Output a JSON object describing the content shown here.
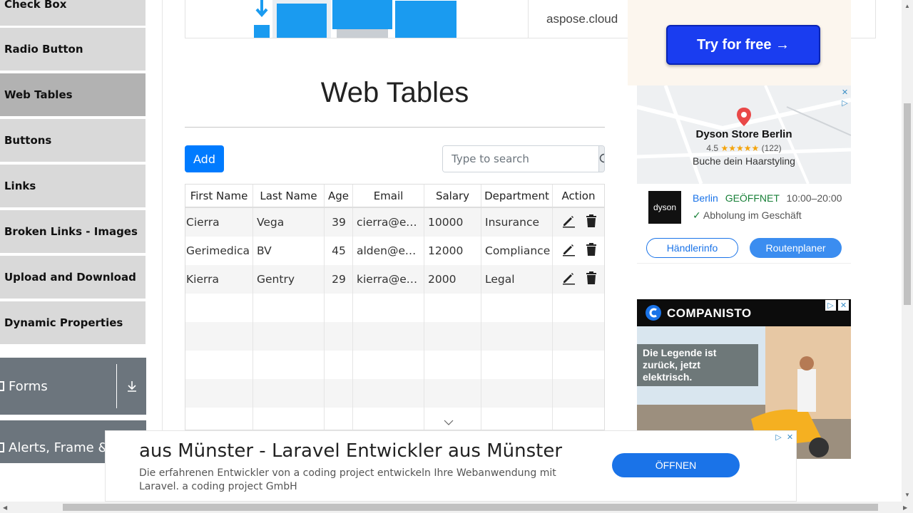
{
  "sidebar": {
    "items": [
      {
        "label": "Check Box"
      },
      {
        "label": "Radio Button"
      },
      {
        "label": "Web Tables",
        "active": true
      },
      {
        "label": "Buttons"
      },
      {
        "label": "Links"
      },
      {
        "label": "Broken Links - Images"
      },
      {
        "label": "Upload and Download"
      },
      {
        "label": "Dynamic Properties"
      }
    ],
    "groups": [
      {
        "label": "Forms",
        "icon": "download-icon"
      },
      {
        "label": "Alerts, Frame &"
      }
    ]
  },
  "top_banner": {
    "domain_text": "aspose.cloud"
  },
  "page": {
    "title": "Web Tables"
  },
  "toolbar": {
    "add_label": "Add"
  },
  "search": {
    "placeholder": "Type to search"
  },
  "table": {
    "columns": [
      "First Name",
      "Last Name",
      "Age",
      "Email",
      "Salary",
      "Department",
      "Action"
    ],
    "rows": [
      {
        "first": "Cierra",
        "last": "Vega",
        "age": "39",
        "email": "cierra@example.com",
        "salary": "10000",
        "department": "Insurance"
      },
      {
        "first": "Gerimedica",
        "last": "BV",
        "age": "45",
        "email": "alden@example.com",
        "salary": "12000",
        "department": "Compliance"
      },
      {
        "first": "Kierra",
        "last": "Gentry",
        "age": "29",
        "email": "kierra@example.com",
        "salary": "2000",
        "department": "Legal"
      }
    ],
    "empty_rows": 5
  },
  "ads": {
    "try": {
      "label": "Try for free →"
    },
    "dyson": {
      "store_name": "Dyson Store Berlin",
      "rating": "4.5",
      "stars": "★★★★★",
      "review_count": "(122)",
      "tagline": "Buche dein Haarstyling",
      "logo_text": "dyson",
      "city": "Berlin",
      "status": "GEÖFFNET",
      "hours": "10:00–20:00",
      "pickup": "Abholung im Geschäft",
      "dealer_label": "Händlerinfo",
      "route_label": "Routenplaner"
    },
    "companisto": {
      "brand": "COMPANISTO",
      "caption": "Die Legende ist zurück, jetzt elektrisch."
    },
    "bottom": {
      "headline": "aus Münster - Laravel Entwickler aus Münster",
      "description": "Die erfahrenen Entwickler von a coding project entwickeln Ihre Webanwendung mit Laravel. a coding project GmbH",
      "open_label": "ÖFFNEN"
    }
  },
  "colors": {
    "primary": "#007bff",
    "sidebar_bg": "#d9d9d9",
    "sidebar_active": "#b2b2b2",
    "group_bg": "#6c757d"
  }
}
